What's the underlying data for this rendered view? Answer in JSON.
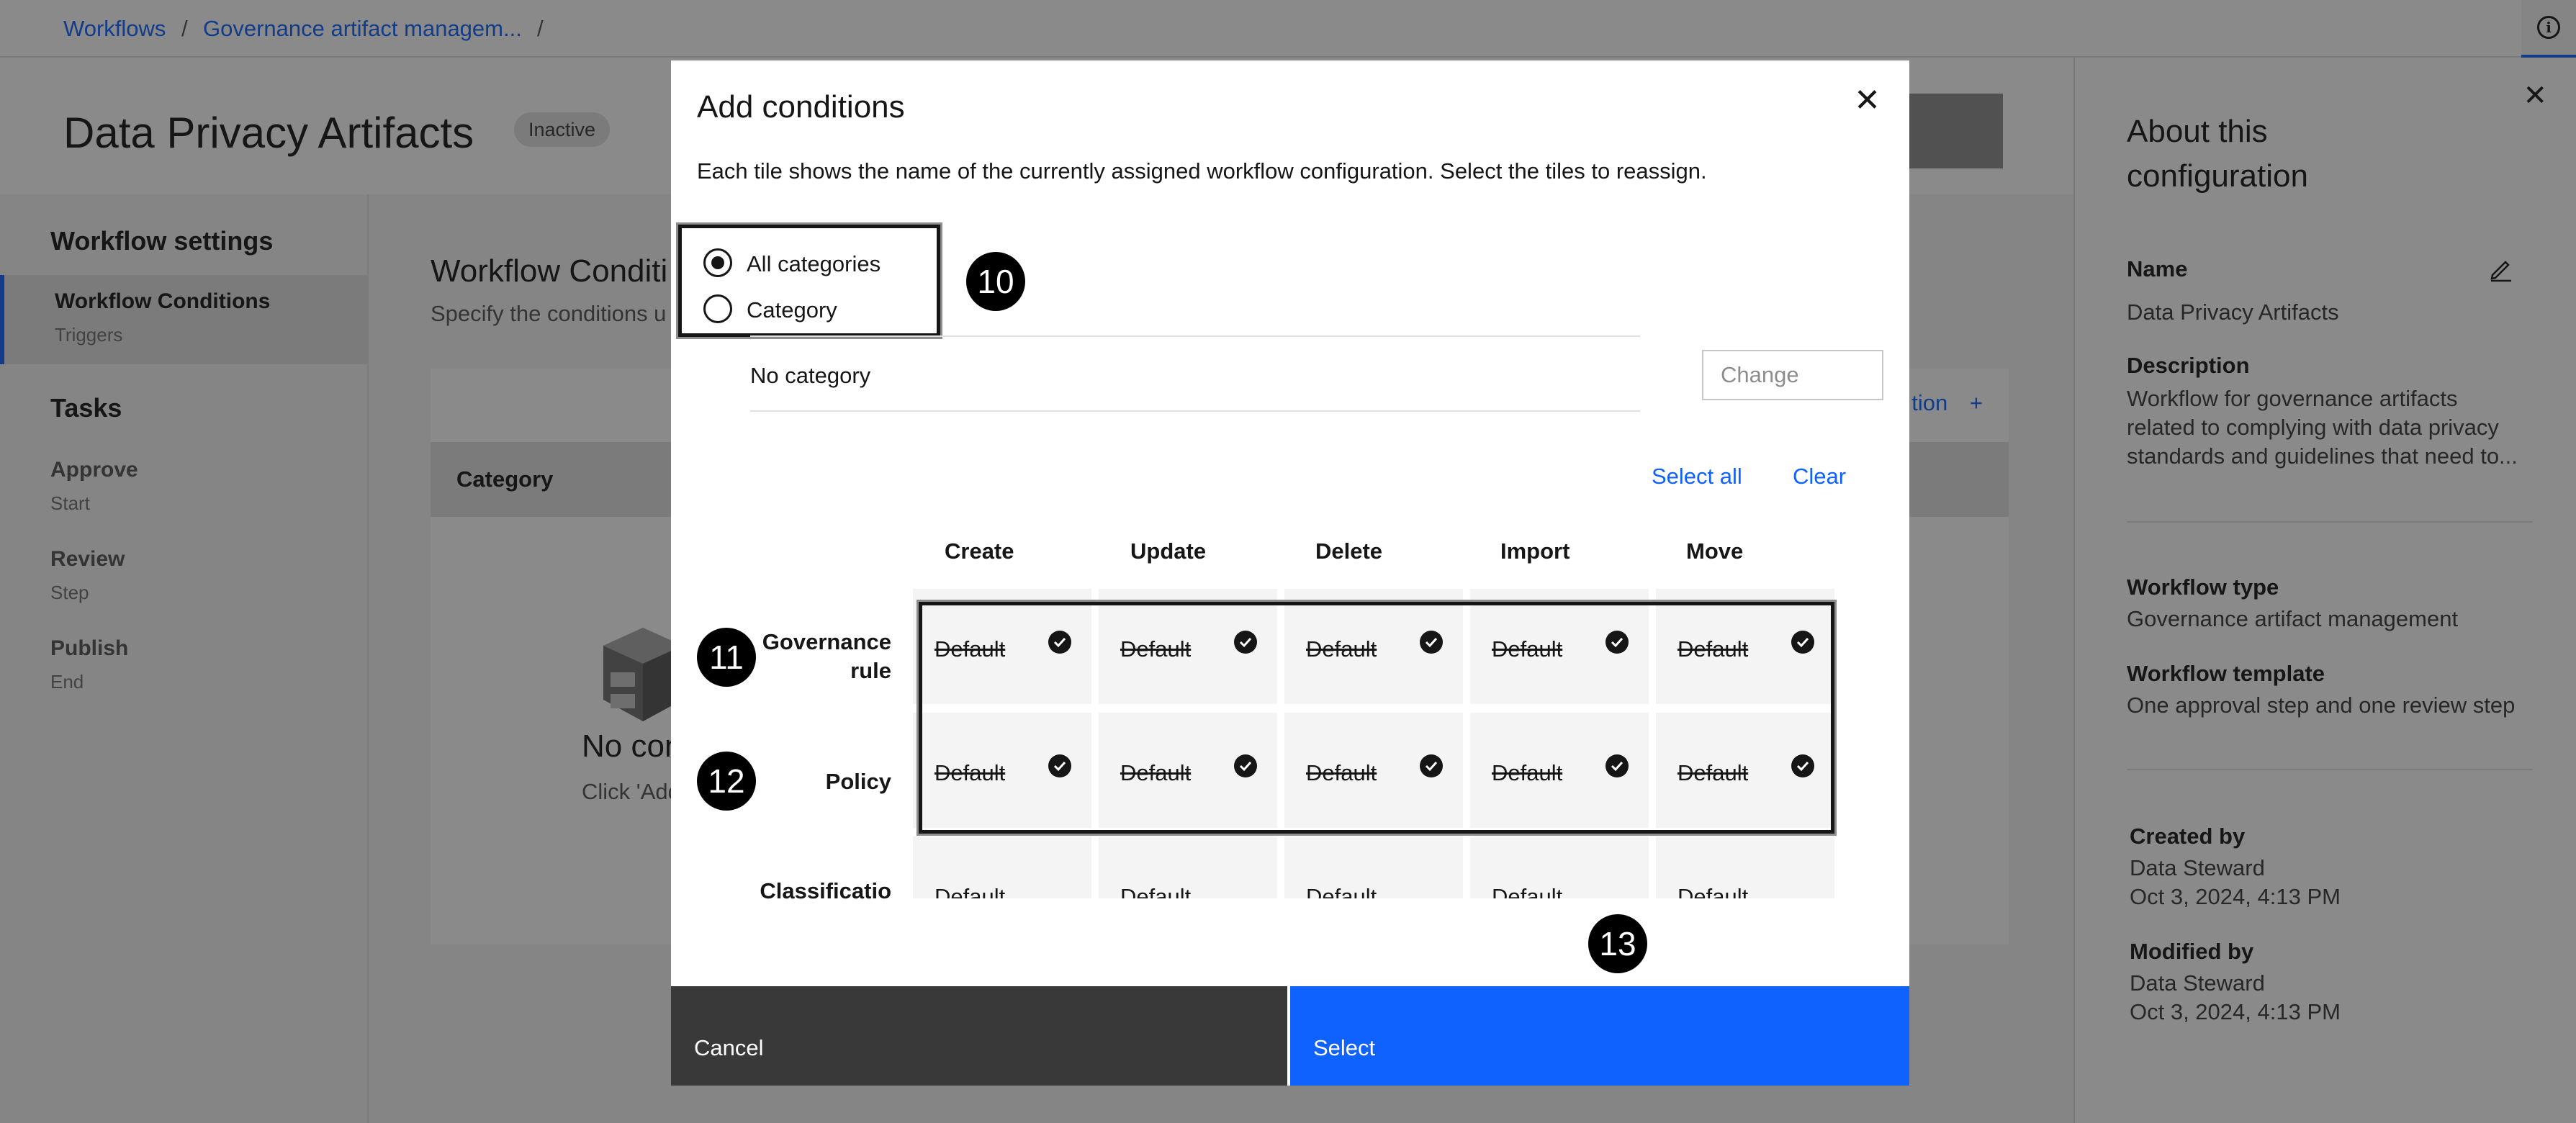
{
  "breadcrumb": {
    "items": [
      "Workflows",
      "Governance artifact managem..."
    ],
    "separator": "/"
  },
  "header": {
    "title": "Data Privacy Artifacts",
    "status": "Inactive"
  },
  "left_nav": {
    "settings_heading": "Workflow settings",
    "active_item": {
      "label": "Workflow Conditions",
      "sub": "Triggers"
    },
    "tasks_heading": "Tasks",
    "tasks": [
      {
        "label": "Approve",
        "sub": "Start"
      },
      {
        "label": "Review",
        "sub": "Step"
      },
      {
        "label": "Publish",
        "sub": "End"
      }
    ]
  },
  "main": {
    "title": "Workflow Conditi",
    "subtitle": "Specify the conditions u",
    "toolbar_link": "tion",
    "table_header": "Category",
    "empty_title": "No conditi",
    "empty_sub": "Click 'Add conc"
  },
  "side_panel": {
    "title": "About this configuration",
    "name_label": "Name",
    "name_value": "Data Privacy Artifacts",
    "description_label": "Description",
    "description_lines": [
      "Workflow for governance artifacts",
      "related to complying with data privacy",
      "standards and guidelines that need to..."
    ],
    "type_label": "Workflow type",
    "type_value": "Governance artifact management",
    "template_label": "Workflow template",
    "template_value": "One approval step and one review step",
    "created_label": "Created by",
    "created_by": "Data Steward",
    "created_date": "Oct 3, 2024, 4:13 PM",
    "modified_label": "Modified by",
    "modified_by": "Data Steward",
    "modified_date": "Oct 3, 2024, 4:13 PM"
  },
  "modal": {
    "title": "Add conditions",
    "description": "Each tile shows the name of the currently assigned workflow configuration. Select the tiles to reassign.",
    "radio_options": [
      "All categories",
      "Category"
    ],
    "selected_radio": "All categories",
    "category_value": "No category",
    "change_placeholder": "Change",
    "select_all": "Select all",
    "clear": "Clear",
    "columns": [
      "Create",
      "Update",
      "Delete",
      "Import",
      "Move"
    ],
    "rows": [
      {
        "label_lines": [
          "Governance",
          "rule"
        ],
        "cells": [
          "Default",
          "Default",
          "Default",
          "Default",
          "Default"
        ],
        "selected": true
      },
      {
        "label_lines": [
          "Policy"
        ],
        "cells": [
          "Default",
          "Default",
          "Default",
          "Default",
          "Default"
        ],
        "selected": true
      },
      {
        "label_lines": [
          "Classificatio"
        ],
        "cells": [
          "Default",
          "Default",
          "Default",
          "Default",
          "Default"
        ],
        "selected": false
      }
    ],
    "callouts": [
      "10",
      "11",
      "12",
      "13"
    ],
    "cancel_label": "Cancel",
    "select_label": "Select"
  },
  "colors": {
    "primary": "#0f62fe",
    "overlay": "rgba(22,22,22,0.5)",
    "cancel_bg": "#393939",
    "tile_bg": "#f4f4f4"
  }
}
